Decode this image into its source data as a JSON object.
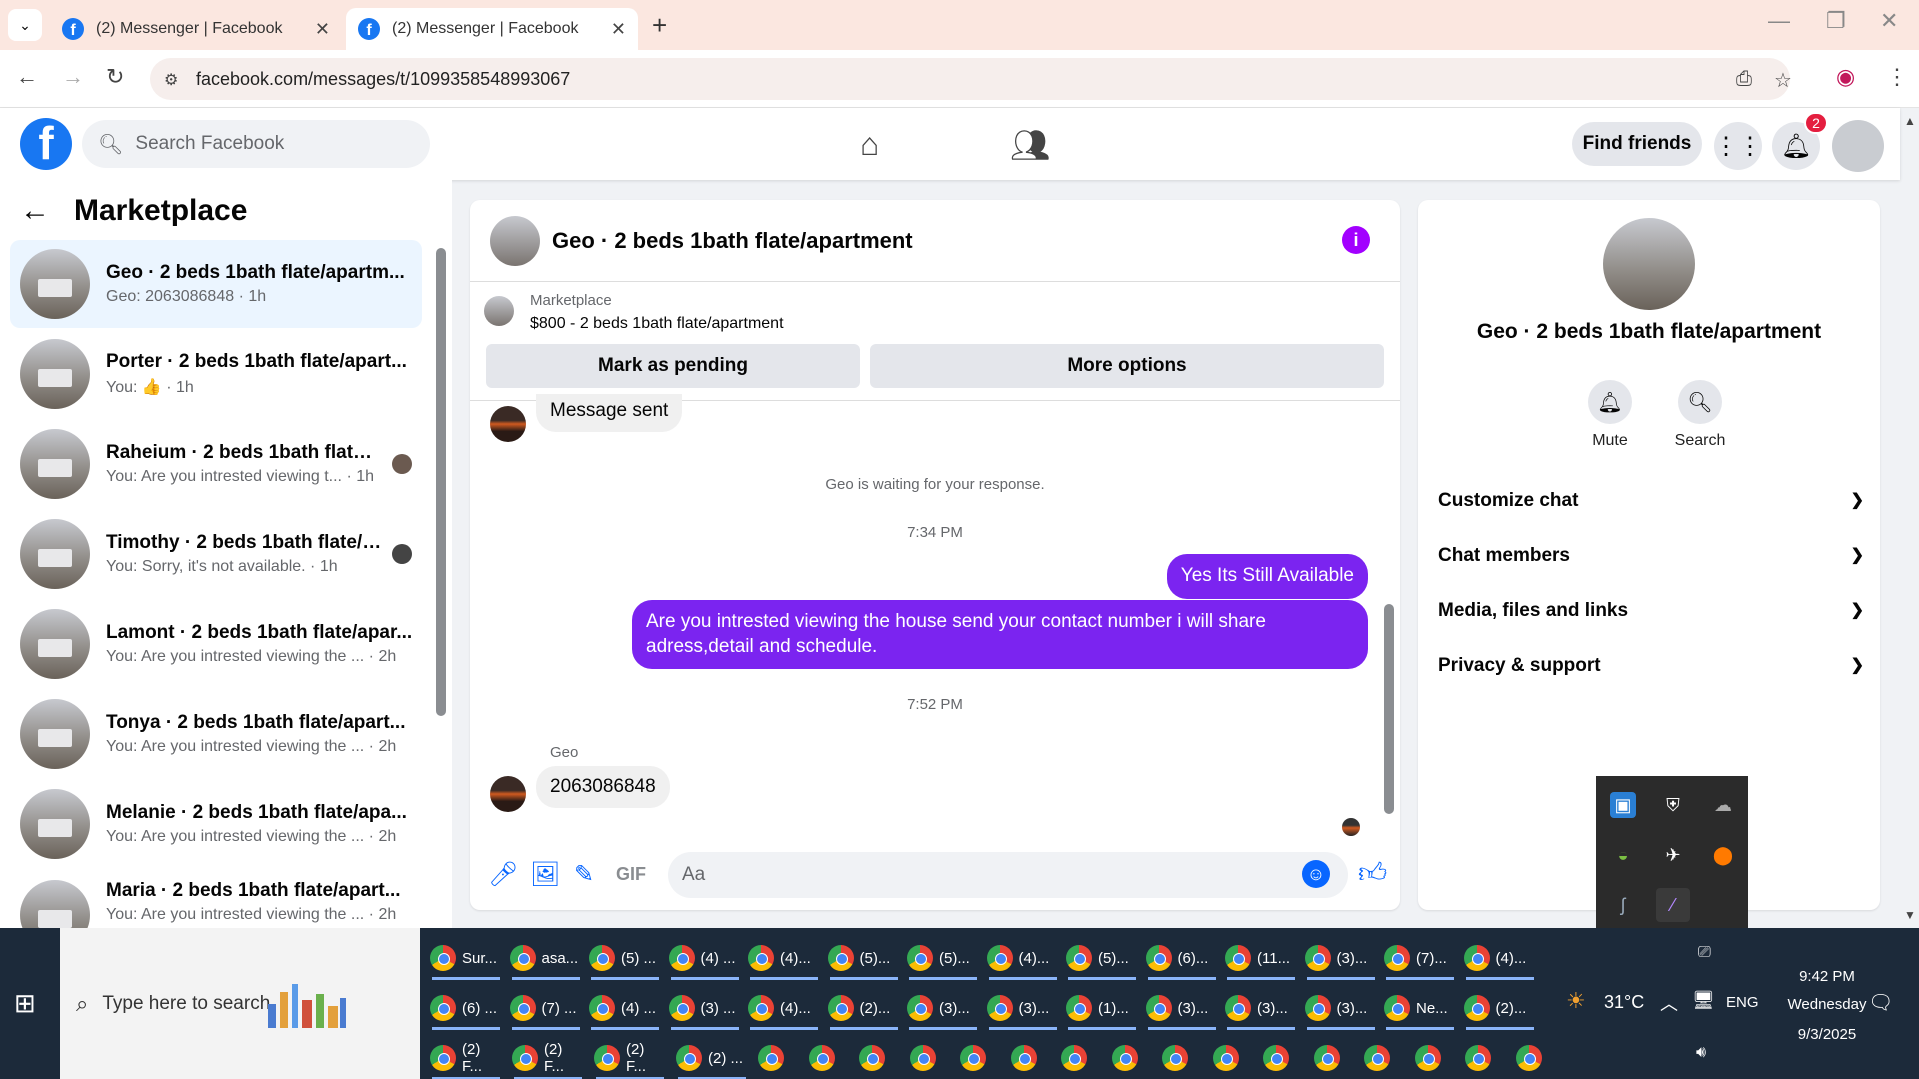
{
  "browser": {
    "tabs": [
      {
        "title": "(2) Messenger | Facebook"
      },
      {
        "title": "(2) Messenger | Facebook"
      }
    ],
    "url": "facebook.com/messages/t/1099358548993067"
  },
  "fb": {
    "logo": "f",
    "search_placeholder": "Search Facebook",
    "find_friends": "Find friends",
    "notification_count": "2"
  },
  "sidebar": {
    "title": "Marketplace",
    "conversations": [
      {
        "name": "Geo · 2 beds 1bath flate/apartm...",
        "sub": "Geo: 2063086848 · 1h"
      },
      {
        "name": "Porter · 2 beds 1bath flate/apart...",
        "sub": "You: 👍 · 1h"
      },
      {
        "name": "Raheium · 2 beds 1bath flate/...",
        "sub": "You: Are you intrested viewing t... · 1h"
      },
      {
        "name": "Timothy · 2 beds 1bath flate/a...",
        "sub": "You: Sorry, it's not available. · 1h"
      },
      {
        "name": "Lamont · 2 beds 1bath flate/apar...",
        "sub": "You: Are you intrested viewing the ... · 2h"
      },
      {
        "name": "Tonya · 2 beds 1bath flate/apart...",
        "sub": "You: Are you intrested viewing the ... · 2h"
      },
      {
        "name": "Melanie · 2 beds 1bath flate/apa...",
        "sub": "You: Are you intrested viewing the ... · 2h"
      },
      {
        "name": "Maria · 2 beds 1bath flate/apart...",
        "sub": "You: Are you intrested viewing the ... · 2h"
      }
    ]
  },
  "chat": {
    "title": "Geo · 2 beds 1bath flate/apartment",
    "marketplace_label": "Marketplace",
    "listing": "$800 - 2 beds 1bath flate/apartment",
    "mark_pending": "Mark as pending",
    "more_options": "More options",
    "messages": {
      "sent_notice": "Message sent",
      "waiting": "Geo is waiting for your response.",
      "time1": "7:34 PM",
      "out1": "Yes Its Still Available",
      "out2": "Are you intrested viewing the house send your contact number i will share adress,detail and schedule.",
      "time2": "7:52 PM",
      "sender": "Geo",
      "in1": "2063086848"
    },
    "composer_placeholder": "Aa"
  },
  "info": {
    "name": "Geo · 2 beds 1bath flate/apartment",
    "mute": "Mute",
    "search": "Search",
    "sections": [
      "Customize chat",
      "Chat members",
      "Media, files and links",
      "Privacy & support"
    ]
  },
  "taskbar": {
    "search_placeholder": "Type here to search",
    "row1": [
      "Sur...",
      "asa...",
      "(5) ...",
      "(4) ...",
      "(4)...",
      "(5)...",
      "(5)...",
      "(4)...",
      "(5)...",
      "(6)...",
      "(11...",
      "(3)...",
      "(7)...",
      "(4)..."
    ],
    "row2": [
      "(6) ...",
      "(7) ...",
      "(4) ...",
      "(3) ...",
      "(4)...",
      "(2)...",
      "(3)...",
      "(3)...",
      "(1)...",
      "(3)...",
      "(3)...",
      "(3)...",
      "Ne...",
      "(2)..."
    ],
    "row3": [
      "(2) F...",
      "(2) F...",
      "(2) F...",
      "(2) ..."
    ],
    "weather": "31°C",
    "lang": "ENG",
    "time": "9:42 PM",
    "day": "Wednesday",
    "date": "9/3/2025"
  }
}
